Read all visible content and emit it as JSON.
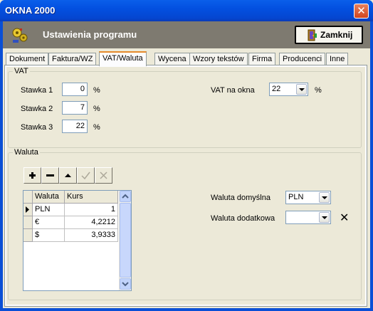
{
  "window": {
    "title": "OKNA 2000",
    "close_glyph": "✕"
  },
  "header": {
    "title": "Ustawienia programu",
    "close_label": "Zamknij",
    "header_color": "#7E7A70"
  },
  "tabs": [
    {
      "label": "Dokument",
      "active": false
    },
    {
      "label": "Faktura/WZ",
      "active": false
    },
    {
      "label": "VAT/Waluta",
      "active": true
    },
    {
      "label": "Wycena",
      "active": false
    },
    {
      "label": "Wzory tekstów",
      "active": false
    },
    {
      "label": "Firma",
      "active": false
    },
    {
      "label": "Producenci",
      "active": false
    },
    {
      "label": "Inne",
      "active": false
    }
  ],
  "vat": {
    "legend": "VAT",
    "rates": [
      {
        "label": "Stawka 1",
        "value": "0",
        "unit": "%"
      },
      {
        "label": "Stawka 2",
        "value": "7",
        "unit": "%"
      },
      {
        "label": "Stawka 3",
        "value": "22",
        "unit": "%"
      }
    ],
    "windows_vat": {
      "label": "VAT na okna",
      "value": "22",
      "unit": "%"
    }
  },
  "currency": {
    "legend": "Waluta",
    "toolbar": {
      "add": "+",
      "delete": "−",
      "up": "▲",
      "confirm": "✓",
      "cancel": "✕"
    },
    "table": {
      "columns": [
        "Waluta",
        "Kurs"
      ],
      "rows": [
        {
          "currency": "PLN",
          "rate": "1"
        },
        {
          "currency": "€",
          "rate": "4,2212"
        },
        {
          "currency": "$",
          "rate": "3,9333"
        }
      ]
    },
    "default_currency": {
      "label": "Waluta domyślna",
      "value": "PLN"
    },
    "secondary_currency": {
      "label": "Waluta dodatkowa",
      "value": "",
      "clear_glyph": "✕"
    }
  }
}
